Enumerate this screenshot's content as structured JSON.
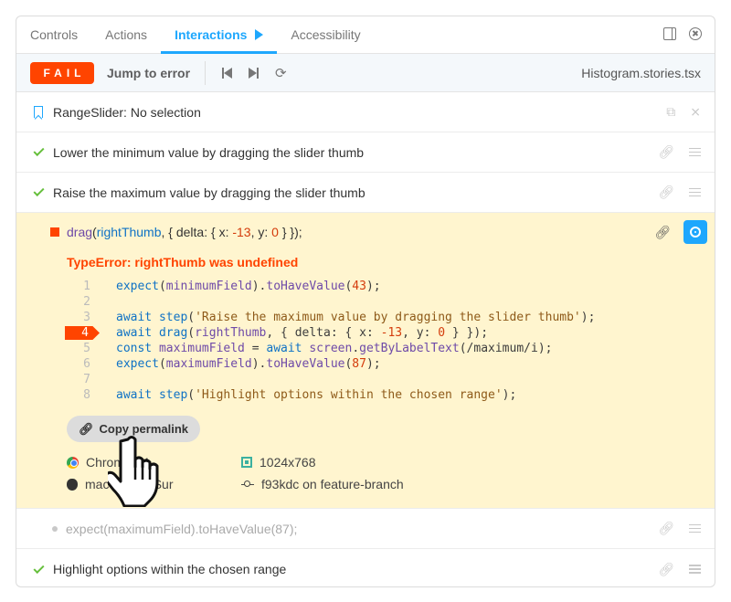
{
  "tabs": [
    {
      "label": "Controls"
    },
    {
      "label": "Actions"
    },
    {
      "label": "Interactions"
    },
    {
      "label": "Accessibility"
    }
  ],
  "toolbar": {
    "status": "FAIL",
    "jump_label": "Jump to error",
    "filename": "Histogram.stories.tsx"
  },
  "story": {
    "title": "RangeSlider: No selection"
  },
  "steps": [
    {
      "label": "Lower the minimum value by dragging the slider thumb",
      "status": "pass"
    },
    {
      "label": "Raise the maximum value by dragging the slider thumb",
      "status": "pass"
    }
  ],
  "error": {
    "call_fn": "drag",
    "call_arg": "rightThumb",
    "call_delta_text": ", { delta: { x: ",
    "call_x": "-13",
    "call_mid": ", y: ",
    "call_y": "0",
    "call_end": " } });",
    "message": "TypeError: rightThumb was undefined",
    "code_lines": [
      {
        "n": "1"
      },
      {
        "n": "2"
      },
      {
        "n": "3"
      },
      {
        "n": "4"
      },
      {
        "n": "5"
      },
      {
        "n": "6"
      },
      {
        "n": "7"
      },
      {
        "n": "8"
      }
    ],
    "permalink_label": "Copy permalink",
    "browser": "Chrome 94",
    "os": "macOS Big Sur",
    "viewport": "1024x768",
    "commit": "f93kdc on feature-branch"
  },
  "after_steps": [
    {
      "label": "expect(maximumField).toHaveValue(87);",
      "status": "pending"
    },
    {
      "label": "Highlight options within the chosen range",
      "status": "pass"
    }
  ],
  "colors": {
    "accent": "#1ea7fd",
    "fail": "#ff4400",
    "pass": "#66bf3c",
    "error_bg": "#fff5cf"
  }
}
